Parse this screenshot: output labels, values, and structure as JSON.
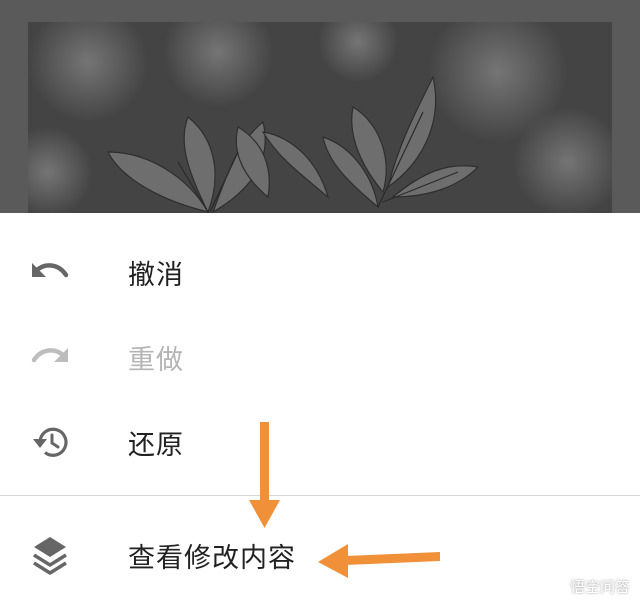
{
  "menu": {
    "items": [
      {
        "label": "撤消",
        "icon": "undo-icon",
        "enabled": true
      },
      {
        "label": "重做",
        "icon": "redo-icon",
        "enabled": false
      },
      {
        "label": "还原",
        "icon": "history-icon",
        "enabled": true
      },
      {
        "label": "查看修改内容",
        "icon": "layers-icon",
        "enabled": true
      }
    ]
  },
  "colors": {
    "overlay": "#5a5a5a",
    "annotation_arrow": "#f0913a",
    "icon": "#666666",
    "icon_disabled": "#bdbdbd"
  },
  "watermark": {
    "text": "悟空问答"
  }
}
